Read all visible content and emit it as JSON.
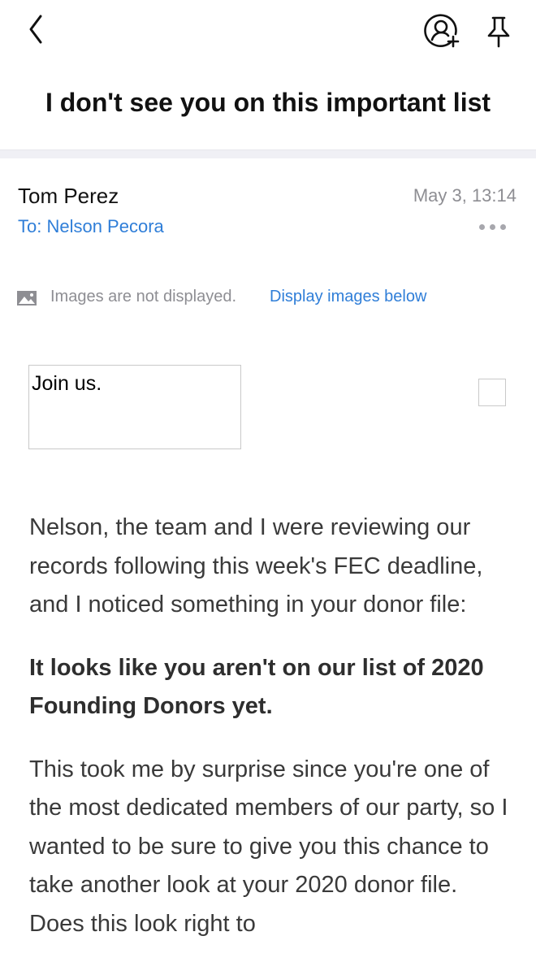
{
  "nav": {
    "back_icon": "chevron-left-icon",
    "add_contact_icon": "person-add-icon",
    "pin_icon": "pin-icon"
  },
  "email": {
    "subject": "I don't see you on this important list",
    "sender": "Tom Perez",
    "date": "May 3, 13:14",
    "recipient": "To: Nelson Pecora",
    "more_icon": "more-dots-icon"
  },
  "images_notice": {
    "icon": "image-icon",
    "message": "Images are not displayed.",
    "link": "Display images below"
  },
  "content": {
    "image_alt": "Join us.",
    "paragraph1": "Nelson, the team and I were reviewing our records following this week's FEC deadline, and I noticed something in your donor file:",
    "paragraph2": "It looks like you aren't on our list of 2020 Founding Donors yet.",
    "paragraph3": "This took me by surprise since you're one of the most dedicated members of our party, so I wanted to be sure to give you this chance to take another look at your 2020 donor file. Does this look right to"
  },
  "colors": {
    "link": "#2f7ed8",
    "muted": "#8e8e93",
    "text": "#3a3a3a"
  }
}
